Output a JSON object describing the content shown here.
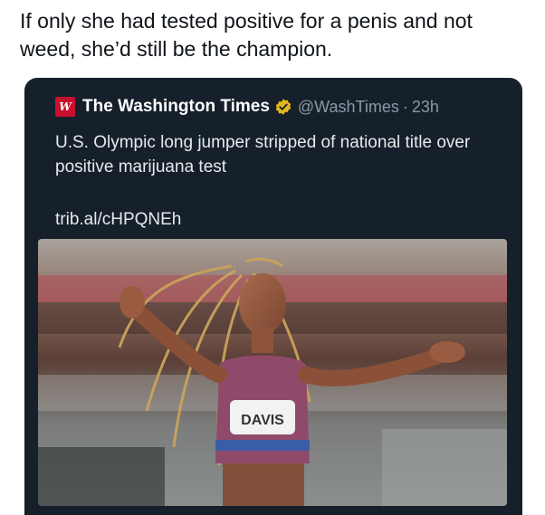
{
  "post": {
    "caption": "If only she had tested positive for a penis and not weed, she’d still be the champion."
  },
  "embedded_tweet": {
    "logo_glyph": "W",
    "account_name": "The Washington Times",
    "handle": "@WashTimes",
    "separator": "·",
    "time": "23h",
    "verified_icon": "gold-verified-badge-icon",
    "text": "U.S. Olympic long jumper stripped of national title over positive marijuana test",
    "link": "trib.al/cHPQNEh",
    "image": {
      "description_icon": "athlete-photo",
      "bib_text": "DAVIS"
    }
  },
  "colors": {
    "card_bg": "#15202b",
    "logo_bg": "#c8102e",
    "verified": "#e2b719",
    "muted_text": "#8b98a5",
    "tweet_text": "#e7e9ea"
  }
}
